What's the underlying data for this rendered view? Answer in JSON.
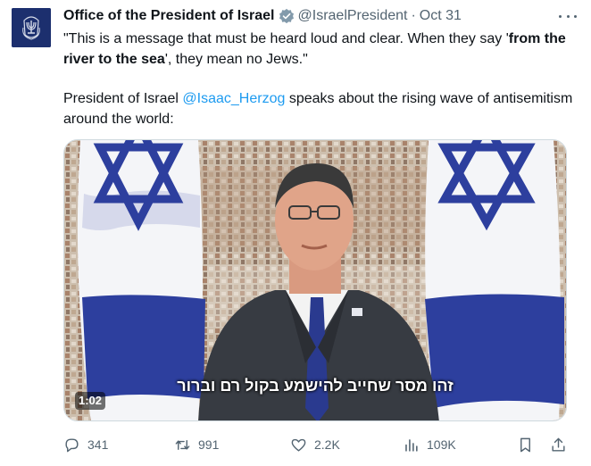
{
  "author": {
    "name": "Office of the President of Israel",
    "handle": "@IsraelPresident",
    "separator": "·",
    "date": "Oct 31",
    "avatar_icon": "menorah-emblem-icon",
    "verified_icon": "gray-verified-badge-icon"
  },
  "tweet": {
    "line1_part1": "\"This is a message that must be heard loud and clear. When they say '",
    "line1_bold": "from the river to the sea",
    "line1_part2": "', they mean no Jews.\"",
    "line2_part1": "President of Israel ",
    "line2_mention": "@Isaac_Herzog",
    "line2_part2": " speaks about the rising wave of antisemitism around the world:"
  },
  "media": {
    "duration": "1:02",
    "subtitle": "זהו מסר שחייב להישמע בקול רם וברור"
  },
  "actions": {
    "replies": "341",
    "retweets": "991",
    "likes": "2.2K",
    "views": "109K",
    "reply_icon": "reply-icon",
    "retweet_icon": "retweet-icon",
    "like_icon": "heart-icon",
    "views_icon": "views-chart-icon",
    "bookmark_icon": "bookmark-icon",
    "share_icon": "share-icon"
  },
  "colors": {
    "text": "#0f1419",
    "secondary": "#536471",
    "link": "#1d9bf0",
    "flag_blue": "#2d3f9e",
    "avatar_bg": "#1c2f6e"
  }
}
